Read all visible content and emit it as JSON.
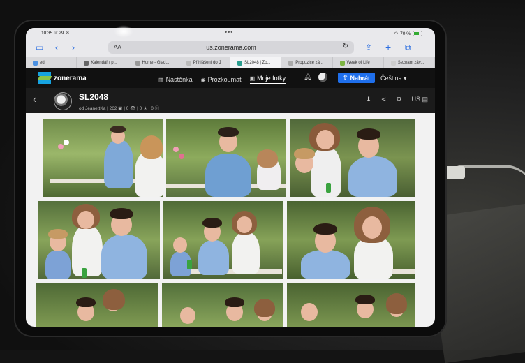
{
  "status_bar": {
    "time": "10:35 út 29. 8.",
    "battery": "70 %"
  },
  "toolbar": {
    "address_prefix": "AA",
    "url": "us.zonerama.com"
  },
  "tabs": [
    {
      "label": "ed"
    },
    {
      "label": "Kalendář / p..."
    },
    {
      "label": "Home - Glad..."
    },
    {
      "label": "Přihlášení do J"
    },
    {
      "label": "SL2048 | Zo..."
    },
    {
      "label": "Propozice zá..."
    },
    {
      "label": "Week of Life"
    },
    {
      "label": "Seznam záv..."
    }
  ],
  "site": {
    "logo": "zonerama",
    "nav": [
      {
        "label": "Nástěnka",
        "icon": "chart-icon"
      },
      {
        "label": "Prozkoumat",
        "icon": "compass-icon"
      },
      {
        "label": "Moje fotky",
        "icon": "photos-icon"
      }
    ],
    "upload_label": "Nahrát",
    "language": "Čeština"
  },
  "album": {
    "title": "SL2048",
    "meta": "od JeanettKa | 262 ▣ | 0 👁 | 0 ★ | 0 ⓘ",
    "region": "US"
  },
  "colors": {
    "accent": "#1f6feb",
    "nav_bg": "#111111",
    "album_bg": "#1b1b1b"
  }
}
